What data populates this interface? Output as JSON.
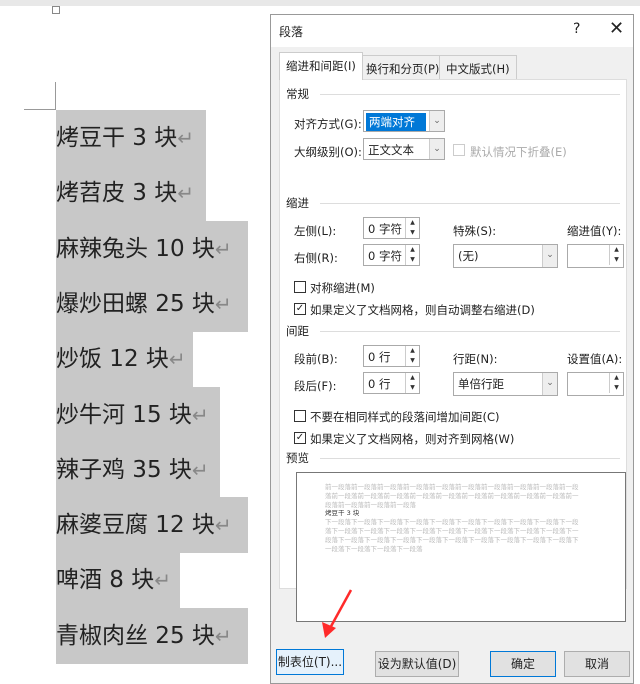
{
  "document": {
    "lines": [
      "烤豆干 3 块",
      "烤苕皮 3 块",
      "麻辣兔头 10 块",
      "爆炒田螺 25 块",
      "炒饭 12 块",
      "炒牛河 15 块",
      "辣子鸡 35 块",
      "麻婆豆腐 12 块",
      "啤酒 8 块",
      "青椒肉丝 25 块"
    ],
    "para_mark": "↵"
  },
  "dialog": {
    "title": "段落",
    "help": "?",
    "close": "✕",
    "tabs": [
      {
        "label": "缩进和间距(I)",
        "active": true
      },
      {
        "label": "换行和分页(P)"
      },
      {
        "label": "中文版式(H)"
      }
    ],
    "general": {
      "heading": "常规",
      "alignment_label": "对齐方式(G):",
      "alignment_value": "两端对齐",
      "outline_label": "大纲级别(O):",
      "outline_value": "正文文本",
      "collapse_label": "默认情况下折叠(E)"
    },
    "indent": {
      "heading": "缩进",
      "left_label": "左侧(L):",
      "left_value": "0 字符",
      "right_label": "右侧(R):",
      "right_value": "0 字符",
      "special_label": "特殊(S):",
      "special_value": "(无)",
      "by_label": "缩进值(Y):",
      "by_value": "",
      "mirror_label": "对称缩进(M)",
      "mirror_checked": false,
      "auto_adjust_label": "如果定义了文档网格，则自动调整右缩进(D)",
      "auto_adjust_checked": true
    },
    "spacing": {
      "heading": "间距",
      "before_label": "段前(B):",
      "before_value": "0 行",
      "after_label": "段后(F):",
      "after_value": "0 行",
      "line_label": "行距(N):",
      "line_value": "单倍行距",
      "at_label": "设置值(A):",
      "at_value": "",
      "no_space_label": "不要在相同样式的段落间增加间距(C)",
      "no_space_checked": false,
      "snap_label": "如果定义了文档网格，则对齐到网格(W)",
      "snap_checked": true
    },
    "preview": {
      "heading": "预览",
      "before_text": "前一段落前一段落前一段落前一段落前一段落前一段落前一段落前一段落前一段落前一段落前一段落前一段落前一段落前一段落前一段落前一段落前一段落前一段落前一段落前一段落前一段落前一段落前一段落",
      "sample": "烤豆干 3 块",
      "after_text": "下一段落下一段落下一段落下一段落下一段落下一段落下一段落下一段落下一段落下一段落下一段落下一段落下一段落下一段落下一段落下一段落下一段落下一段落下一段落下一段落下一段落下一段落下一段落下一段落下一段落下一段落下一段落下一段落下一段落下一段落下一段落下一段落下一段落"
    },
    "buttons": {
      "tabs": "制表位(T)...",
      "default": "设为默认值(D)",
      "ok": "确定",
      "cancel": "取消"
    }
  },
  "annotation": {
    "arrow_color": "#ff2a2a"
  }
}
